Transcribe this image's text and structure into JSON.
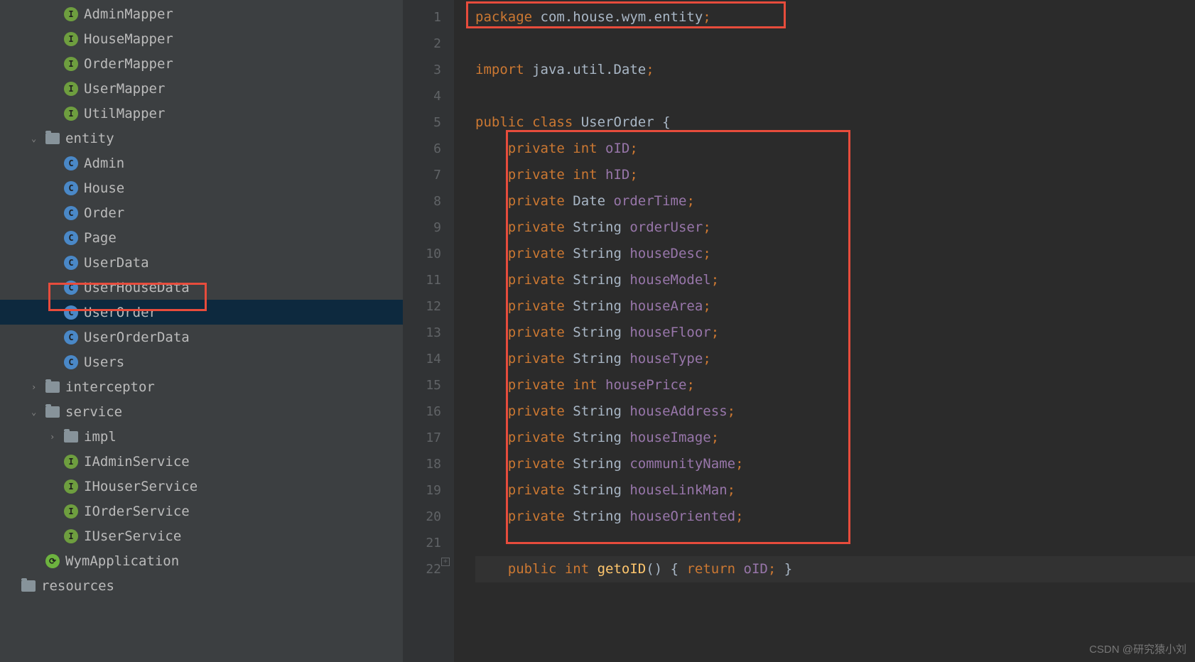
{
  "sidebar": {
    "items": [
      {
        "indent": 2,
        "icon": "interface",
        "iconChar": "I",
        "label": "AdminMapper",
        "chevron": ""
      },
      {
        "indent": 2,
        "icon": "interface",
        "iconChar": "I",
        "label": "HouseMapper",
        "chevron": ""
      },
      {
        "indent": 2,
        "icon": "interface",
        "iconChar": "I",
        "label": "OrderMapper",
        "chevron": ""
      },
      {
        "indent": 2,
        "icon": "interface",
        "iconChar": "I",
        "label": "UserMapper",
        "chevron": ""
      },
      {
        "indent": 2,
        "icon": "interface",
        "iconChar": "I",
        "label": "UtilMapper",
        "chevron": ""
      },
      {
        "indent": 1,
        "icon": "folder",
        "iconChar": "",
        "label": "entity",
        "chevron": "down"
      },
      {
        "indent": 2,
        "icon": "class",
        "iconChar": "C",
        "label": "Admin",
        "chevron": ""
      },
      {
        "indent": 2,
        "icon": "class",
        "iconChar": "C",
        "label": "House",
        "chevron": ""
      },
      {
        "indent": 2,
        "icon": "class",
        "iconChar": "C",
        "label": "Order",
        "chevron": ""
      },
      {
        "indent": 2,
        "icon": "class",
        "iconChar": "C",
        "label": "Page",
        "chevron": ""
      },
      {
        "indent": 2,
        "icon": "class",
        "iconChar": "C",
        "label": "UserData",
        "chevron": ""
      },
      {
        "indent": 2,
        "icon": "class",
        "iconChar": "C",
        "label": "UserHouseData",
        "chevron": ""
      },
      {
        "indent": 2,
        "icon": "class",
        "iconChar": "C",
        "label": "UserOrder",
        "chevron": "",
        "selected": true
      },
      {
        "indent": 2,
        "icon": "class",
        "iconChar": "C",
        "label": "UserOrderData",
        "chevron": ""
      },
      {
        "indent": 2,
        "icon": "class",
        "iconChar": "C",
        "label": "Users",
        "chevron": ""
      },
      {
        "indent": 1,
        "icon": "folder",
        "iconChar": "",
        "label": "interceptor",
        "chevron": "right"
      },
      {
        "indent": 1,
        "icon": "folder",
        "iconChar": "",
        "label": "service",
        "chevron": "down"
      },
      {
        "indent": 2,
        "icon": "folder",
        "iconChar": "",
        "label": "impl",
        "chevron": "right"
      },
      {
        "indent": 2,
        "icon": "interface",
        "iconChar": "I",
        "label": "IAdminService",
        "chevron": ""
      },
      {
        "indent": 2,
        "icon": "interface",
        "iconChar": "I",
        "label": "IHouserService",
        "chevron": ""
      },
      {
        "indent": 2,
        "icon": "interface",
        "iconChar": "I",
        "label": "IOrderService",
        "chevron": ""
      },
      {
        "indent": 2,
        "icon": "interface",
        "iconChar": "I",
        "label": "IUserService",
        "chevron": ""
      },
      {
        "indent": 1,
        "icon": "spring",
        "iconChar": "⟳",
        "label": "WymApplication",
        "chevron": ""
      },
      {
        "indent": 0,
        "icon": "folder",
        "iconChar": "",
        "label": "resources",
        "chevron": ""
      }
    ]
  },
  "editor": {
    "lines": [
      {
        "n": 1,
        "tokens": [
          {
            "c": "kw",
            "t": "package "
          },
          {
            "c": "pkg",
            "t": "com.house.wym.entity"
          },
          {
            "c": "punct",
            "t": ";"
          }
        ]
      },
      {
        "n": 2,
        "tokens": []
      },
      {
        "n": 3,
        "tokens": [
          {
            "c": "kw",
            "t": "import "
          },
          {
            "c": "pkg",
            "t": "java.util.Date"
          },
          {
            "c": "punct",
            "t": ";"
          }
        ]
      },
      {
        "n": 4,
        "tokens": []
      },
      {
        "n": 5,
        "tokens": [
          {
            "c": "kw",
            "t": "public class "
          },
          {
            "c": "type",
            "t": "UserOrder "
          },
          {
            "c": "brace",
            "t": "{"
          }
        ]
      },
      {
        "n": 6,
        "tokens": [
          {
            "c": "",
            "t": "    "
          },
          {
            "c": "kw",
            "t": "private int "
          },
          {
            "c": "ident",
            "t": "oID"
          },
          {
            "c": "punct",
            "t": ";"
          }
        ]
      },
      {
        "n": 7,
        "tokens": [
          {
            "c": "",
            "t": "    "
          },
          {
            "c": "kw",
            "t": "private int "
          },
          {
            "c": "ident",
            "t": "hID"
          },
          {
            "c": "punct",
            "t": ";"
          }
        ]
      },
      {
        "n": 8,
        "tokens": [
          {
            "c": "",
            "t": "    "
          },
          {
            "c": "kw",
            "t": "private "
          },
          {
            "c": "type",
            "t": "Date "
          },
          {
            "c": "ident",
            "t": "orderTime"
          },
          {
            "c": "punct",
            "t": ";"
          }
        ]
      },
      {
        "n": 9,
        "tokens": [
          {
            "c": "",
            "t": "    "
          },
          {
            "c": "kw",
            "t": "private "
          },
          {
            "c": "type",
            "t": "String "
          },
          {
            "c": "ident",
            "t": "orderUser"
          },
          {
            "c": "punct",
            "t": ";"
          }
        ]
      },
      {
        "n": 10,
        "tokens": [
          {
            "c": "",
            "t": "    "
          },
          {
            "c": "kw",
            "t": "private "
          },
          {
            "c": "type",
            "t": "String "
          },
          {
            "c": "ident",
            "t": "houseDesc"
          },
          {
            "c": "punct",
            "t": ";"
          }
        ]
      },
      {
        "n": 11,
        "tokens": [
          {
            "c": "",
            "t": "    "
          },
          {
            "c": "kw",
            "t": "private "
          },
          {
            "c": "type",
            "t": "String "
          },
          {
            "c": "ident",
            "t": "houseModel"
          },
          {
            "c": "punct",
            "t": ";"
          }
        ]
      },
      {
        "n": 12,
        "tokens": [
          {
            "c": "",
            "t": "    "
          },
          {
            "c": "kw",
            "t": "private "
          },
          {
            "c": "type",
            "t": "String "
          },
          {
            "c": "ident",
            "t": "houseArea"
          },
          {
            "c": "punct",
            "t": ";"
          }
        ]
      },
      {
        "n": 13,
        "tokens": [
          {
            "c": "",
            "t": "    "
          },
          {
            "c": "kw",
            "t": "private "
          },
          {
            "c": "type",
            "t": "String "
          },
          {
            "c": "ident",
            "t": "houseFloor"
          },
          {
            "c": "punct",
            "t": ";"
          }
        ]
      },
      {
        "n": 14,
        "tokens": [
          {
            "c": "",
            "t": "    "
          },
          {
            "c": "kw",
            "t": "private "
          },
          {
            "c": "type",
            "t": "String "
          },
          {
            "c": "ident",
            "t": "houseType"
          },
          {
            "c": "punct",
            "t": ";"
          }
        ]
      },
      {
        "n": 15,
        "tokens": [
          {
            "c": "",
            "t": "    "
          },
          {
            "c": "kw",
            "t": "private int "
          },
          {
            "c": "ident",
            "t": "housePrice"
          },
          {
            "c": "punct",
            "t": ";"
          }
        ]
      },
      {
        "n": 16,
        "tokens": [
          {
            "c": "",
            "t": "    "
          },
          {
            "c": "kw",
            "t": "private "
          },
          {
            "c": "type",
            "t": "String "
          },
          {
            "c": "ident",
            "t": "houseAddress"
          },
          {
            "c": "punct",
            "t": ";"
          }
        ]
      },
      {
        "n": 17,
        "tokens": [
          {
            "c": "",
            "t": "    "
          },
          {
            "c": "kw",
            "t": "private "
          },
          {
            "c": "type",
            "t": "String "
          },
          {
            "c": "ident",
            "t": "houseImage"
          },
          {
            "c": "punct",
            "t": ";"
          }
        ]
      },
      {
        "n": 18,
        "tokens": [
          {
            "c": "",
            "t": "    "
          },
          {
            "c": "kw",
            "t": "private "
          },
          {
            "c": "type",
            "t": "String "
          },
          {
            "c": "ident",
            "t": "communityName"
          },
          {
            "c": "punct",
            "t": ";"
          }
        ]
      },
      {
        "n": 19,
        "tokens": [
          {
            "c": "",
            "t": "    "
          },
          {
            "c": "kw",
            "t": "private "
          },
          {
            "c": "type",
            "t": "String "
          },
          {
            "c": "ident",
            "t": "houseLinkMan"
          },
          {
            "c": "punct",
            "t": ";"
          }
        ]
      },
      {
        "n": 20,
        "tokens": [
          {
            "c": "",
            "t": "    "
          },
          {
            "c": "kw",
            "t": "private "
          },
          {
            "c": "type",
            "t": "String "
          },
          {
            "c": "ident",
            "t": "houseOriented"
          },
          {
            "c": "punct",
            "t": ";"
          }
        ]
      },
      {
        "n": 21,
        "tokens": []
      },
      {
        "n": 22,
        "tokens": [
          {
            "c": "",
            "t": "    "
          },
          {
            "c": "kw",
            "t": "public int "
          },
          {
            "c": "method",
            "t": "getoID"
          },
          {
            "c": "brace",
            "t": "() { "
          },
          {
            "c": "kw",
            "t": "return "
          },
          {
            "c": "ident",
            "t": "oID"
          },
          {
            "c": "punct",
            "t": ";"
          },
          {
            "c": "brace",
            "t": " }"
          }
        ],
        "bg": true
      }
    ]
  },
  "watermark": "CSDN @研究猿小刘"
}
